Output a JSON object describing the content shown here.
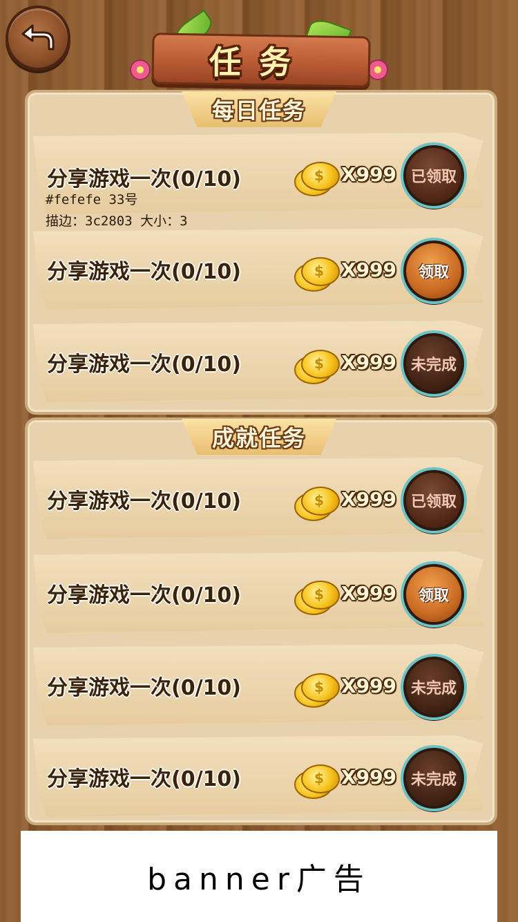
{
  "header": {
    "title": "任务",
    "back_icon": "back-arrow-icon"
  },
  "daily": {
    "heading": "每日任务",
    "rows": [
      {
        "task": "分享游戏一次(0/10)",
        "reward": "X999",
        "action": "已领取",
        "state": "claimed"
      },
      {
        "task": "分享游戏一次(0/10)",
        "reward": "X999",
        "action": "领取",
        "state": "claimable"
      },
      {
        "task": "分享游戏一次(0/10)",
        "reward": "X999",
        "action": "未完成",
        "state": "incomplete"
      }
    ],
    "note_line1": "#fefefe  33号",
    "note_line2": "描边：3c2803  大小：3"
  },
  "achievement": {
    "heading": "成就任务",
    "rows": [
      {
        "task": "分享游戏一次(0/10)",
        "reward": "X999",
        "action": "已领取",
        "state": "claimed"
      },
      {
        "task": "分享游戏一次(0/10)",
        "reward": "X999",
        "action": "领取",
        "state": "claimable"
      },
      {
        "task": "分享游戏一次(0/10)",
        "reward": "X999",
        "action": "未完成",
        "state": "incomplete"
      },
      {
        "task": "分享游戏一次(0/10)",
        "reward": "X999",
        "action": "未完成",
        "state": "incomplete"
      }
    ]
  },
  "banner": {
    "label": "banner广告"
  },
  "colors": {
    "text_fill": "#fefefe",
    "text_stroke": "#3c2803"
  }
}
